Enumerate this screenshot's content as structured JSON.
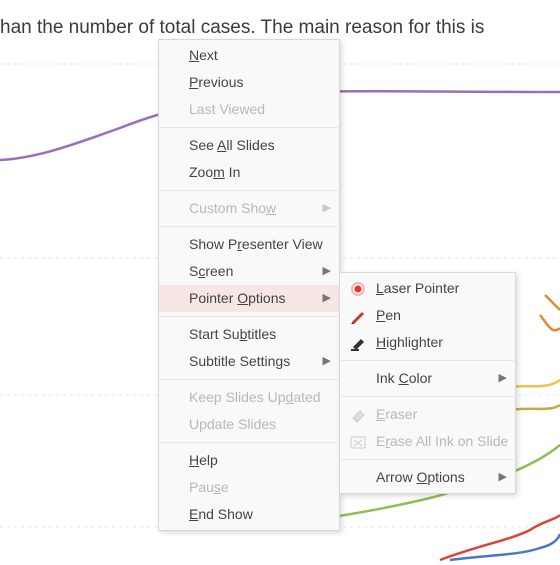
{
  "behind_text": "han the number of total cases. The main reason for this is",
  "menu": {
    "next": {
      "pre": "",
      "mn": "N",
      "post": "ext"
    },
    "previous": {
      "pre": "",
      "mn": "P",
      "post": "revious"
    },
    "last_viewed": "Last Viewed",
    "see_all": {
      "pre": "See ",
      "mn": "A",
      "post": "ll Slides"
    },
    "zoom_in": {
      "pre": "Zoo",
      "mn": "m",
      "post": " In"
    },
    "custom_show": {
      "pre": "Custom Sho",
      "mn": "w",
      "post": ""
    },
    "presenter": {
      "pre": "Show P",
      "mn": "r",
      "post": "esenter View"
    },
    "screen": {
      "pre": "S",
      "mn": "c",
      "post": "reen"
    },
    "pointer": {
      "pre": "Pointer ",
      "mn": "O",
      "post": "ptions"
    },
    "start_sub": {
      "pre": "Start Su",
      "mn": "b",
      "post": "titles"
    },
    "sub_settings": {
      "pre": "Subtitle Settin",
      "mn": "g",
      "post": "s"
    },
    "keep_updated": {
      "pre": "Keep Slides Up",
      "mn": "d",
      "post": "ated"
    },
    "update_slides": "Update Slides",
    "help": {
      "pre": "",
      "mn": "H",
      "post": "elp"
    },
    "pause": {
      "pre": "Pau",
      "mn": "s",
      "post": "e"
    },
    "end_show": {
      "pre": "",
      "mn": "E",
      "post": "nd Show"
    }
  },
  "submenu": {
    "laser": {
      "pre": "",
      "mn": "L",
      "post": "aser Pointer"
    },
    "pen": {
      "pre": "",
      "mn": "P",
      "post": "en"
    },
    "highlighter": {
      "pre": "",
      "mn": "H",
      "post": "ighlighter"
    },
    "ink_color": {
      "pre": "Ink ",
      "mn": "C",
      "post": "olor"
    },
    "eraser": {
      "pre": "",
      "mn": "E",
      "post": "raser"
    },
    "erase_all": {
      "pre": "E",
      "mn": "r",
      "post": "ase All Ink on Slide"
    },
    "arrow": {
      "pre": "Arrow ",
      "mn": "O",
      "post": "ptions"
    }
  },
  "colors": {
    "laser": "#e22",
    "pen": "#c0392b",
    "highlighter": "#222"
  }
}
